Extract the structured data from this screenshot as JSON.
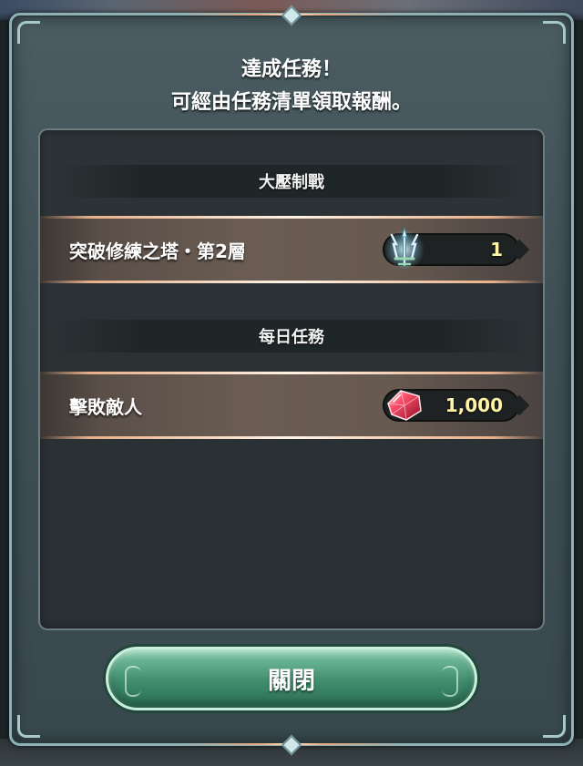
{
  "message": {
    "line1": "達成任務！",
    "line2": "可經由任務清單領取報酬。"
  },
  "sections": [
    {
      "header": "大壓制戰",
      "quest": {
        "label": "突破修練之塔・第2層",
        "reward": {
          "icon": "tower-scroll-icon",
          "value": "1"
        }
      }
    },
    {
      "header": "每日任務",
      "quest": {
        "label": "擊敗敵人",
        "reward": {
          "icon": "red-orb-icon",
          "value": "1,000"
        }
      }
    }
  ],
  "close_button": {
    "label": "關閉"
  },
  "colors": {
    "dialog_border": "#8fb1b6",
    "reward_text": "#fff3a6",
    "button_green": "#3f8c6d",
    "accent_copper": "#e8b08a"
  }
}
